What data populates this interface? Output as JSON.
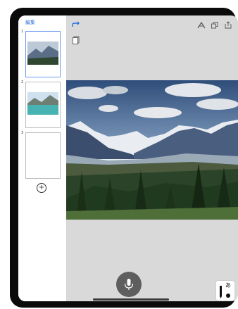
{
  "sidebar": {
    "edit_label": "編集",
    "pages": [
      {
        "number": "1"
      },
      {
        "number": "2"
      },
      {
        "number": "3"
      }
    ],
    "add_label": "+"
  },
  "toolbar": {
    "icons": [
      "redo-icon",
      "page-icon",
      "text-recognition-icon",
      "copy-icon",
      "share-icon",
      "close-icon"
    ]
  },
  "ink_tool": {
    "label": "あ"
  }
}
